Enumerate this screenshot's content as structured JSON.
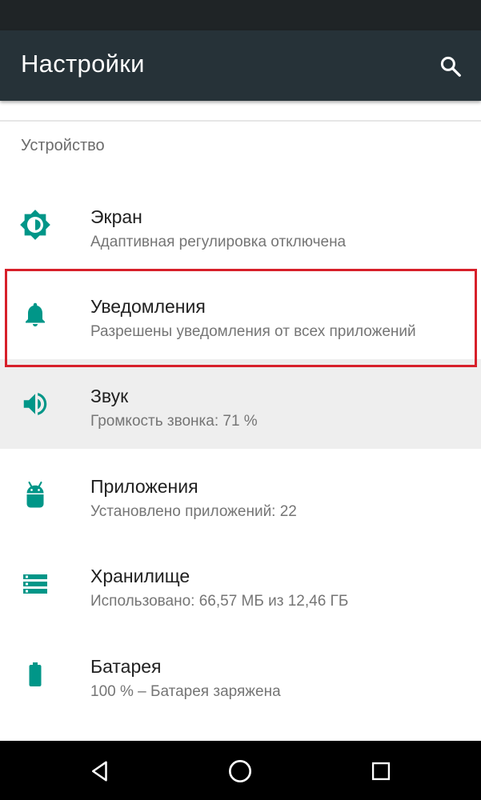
{
  "app_bar": {
    "title": "Настройки",
    "search_icon": "search-icon",
    "background": "#263238"
  },
  "section": {
    "header": "Устройство"
  },
  "items": [
    {
      "title": "Экран",
      "subtitle": "Адаптивная регулировка отключена",
      "icon": "brightness-icon"
    },
    {
      "title": "Уведомления",
      "subtitle": "Разрешены уведомления от всех приложений",
      "icon": "bell-icon",
      "highlighted": true
    },
    {
      "title": "Звук",
      "subtitle": "Громкость звонка: 71 %",
      "icon": "volume-icon",
      "pressed": true
    },
    {
      "title": "Приложения",
      "subtitle": "Установлено приложений: 22",
      "icon": "android-icon"
    },
    {
      "title": "Хранилище",
      "subtitle": "Использовано: 66,57 МБ из 12,46 ГБ",
      "icon": "storage-icon"
    },
    {
      "title": "Батарея",
      "subtitle": "100 % – Батарея заряжена",
      "icon": "battery-icon"
    }
  ],
  "nav_bar": {
    "buttons": [
      "back-icon",
      "home-icon",
      "recents-icon"
    ]
  },
  "colors": {
    "accent": "#009688",
    "highlight_border": "#d7202a"
  }
}
